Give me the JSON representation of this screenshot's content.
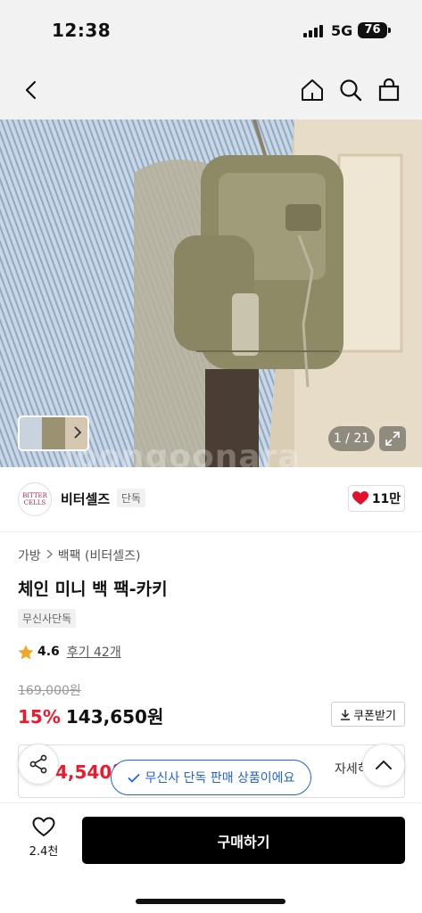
{
  "status_bar": {
    "time": "12:38",
    "network": "5G",
    "battery": "76"
  },
  "nav": {
    "icons": [
      "back-icon",
      "home-icon",
      "search-icon",
      "shopping-bag-icon"
    ]
  },
  "gallery": {
    "counter": "1 / 21",
    "watermark": "Joongoonara"
  },
  "brand": {
    "logo_line1": "BITTER",
    "logo_line2": "CELLS",
    "name": "비터셀즈",
    "badge": "단독",
    "likes": "11만"
  },
  "breadcrumb": {
    "category": "가방",
    "subcategory": "백팩 (비터셀즈)"
  },
  "product": {
    "title": "체인 미니 백 팩-카키",
    "exclusive_tag": "무신사단독",
    "rating": "4.6",
    "review_label": "후기 42개",
    "original_price": "169,000원",
    "discount": "15%",
    "price": "143,650원",
    "coupon_label": "쿠폰받기"
  },
  "max_benefit": {
    "price_partial": "4,540원",
    "detail_label": "자세히"
  },
  "toast": {
    "text": "무신사 단독 판매 상품이에요"
  },
  "bottom": {
    "wish_count": "2.4천",
    "buy_label": "구매하기"
  },
  "colors": {
    "discount_red": "#f0182d",
    "toast_blue": "#1f5fe8",
    "heart_red": "#e5112c"
  }
}
